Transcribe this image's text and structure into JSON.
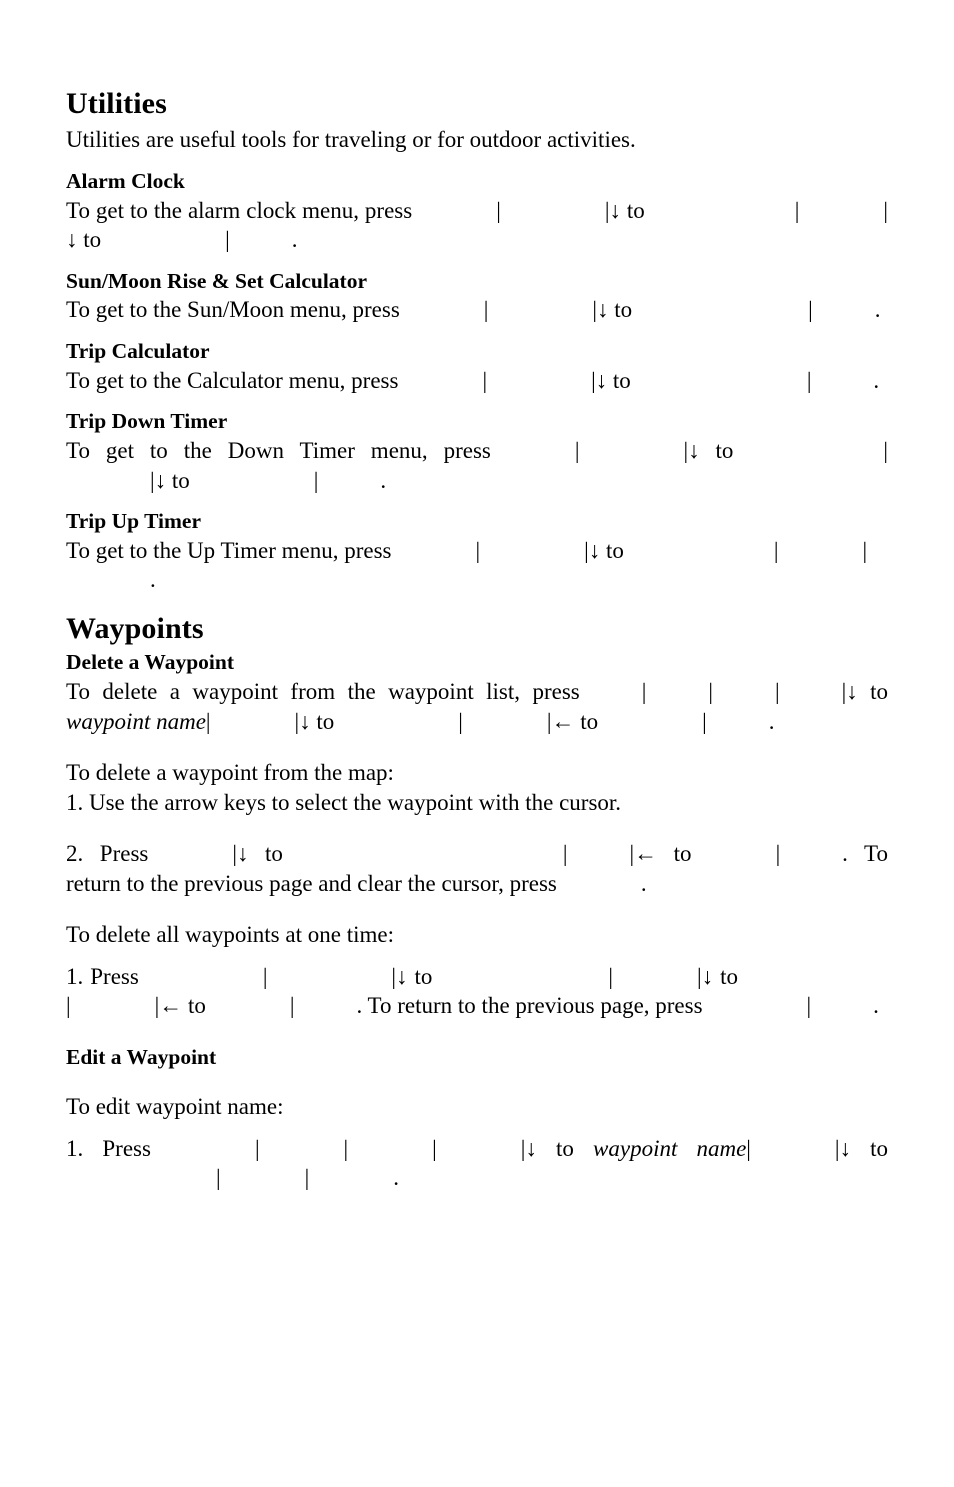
{
  "page": {
    "chapter_title": "Utilities",
    "intro": "Utilities are useful tools for traveling or for outdoor activities.",
    "sections": [
      {
        "heading": "Alarm Clock",
        "lead": "To get to the alarm clock menu, press",
        "connector_to": "to",
        "terminator": "."
      },
      {
        "heading": "Sun/Moon Rise & Set Calculator",
        "lead": "To get to the Sun/Moon menu, press",
        "connector_to": "to",
        "terminator": "."
      },
      {
        "heading": "Trip Calculator",
        "lead": "To get to the Calculator menu, press",
        "connector_to": "to",
        "terminator": "."
      },
      {
        "heading": "Trip Down Timer",
        "lead": "To get to the Down Timer menu, press",
        "connector_to": "to",
        "terminator": "."
      },
      {
        "heading": "Trip Up Timer",
        "lead": "To get to the Up Timer menu, press",
        "connector_to": "to",
        "terminator": "."
      }
    ]
  },
  "waypoints": {
    "chapter_title": "Waypoints",
    "delete_waypoint": {
      "heading": "Delete a Waypoint",
      "lead": "To delete a waypoint from the waypoint list, press",
      "connector_to": "to",
      "waypoint_name_italic": "waypoint name",
      "terminator": "."
    },
    "delete_from_map": {
      "lead_in": "To delete a waypoint from the map:",
      "step1": "1. Use the arrow keys to select the waypoint with the cursor.",
      "step2_prefix": "2. Press",
      "connector_to": "to",
      "step2_mid": ". To return to the previous page and clear the cursor, press",
      "terminator": "."
    },
    "delete_all": {
      "lead_in": "To delete all waypoints at one time:",
      "step1_prefix": "1. Press",
      "connector_to": "to",
      "mid_sentence": ". To return to the previous page, press",
      "terminator": "."
    },
    "edit_waypoint": {
      "heading": "Edit a Waypoint",
      "lead_in": "To edit waypoint name:",
      "step1_prefix": "1. Press",
      "connector_to": "to",
      "waypoint_name_italic": "waypoint name",
      "terminator": "."
    }
  },
  "glyphs": {
    "separator": "|",
    "arrow_down": "↓",
    "arrow_left": "←"
  }
}
